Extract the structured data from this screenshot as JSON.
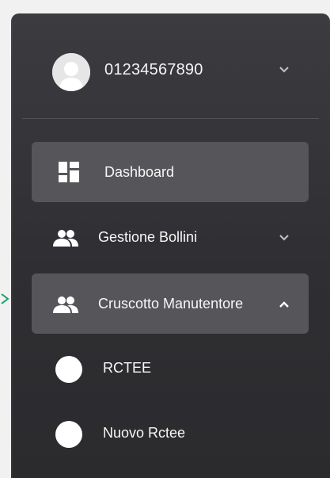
{
  "user": {
    "name": "01234567890"
  },
  "nav": {
    "dashboard": "Dashboard",
    "gestione_bollini": "Gestione Bollini",
    "cruscotto": "Cruscotto Manutentore"
  },
  "submenu": {
    "items": [
      "RCTEE",
      "Nuovo Rctee"
    ]
  },
  "icons": {
    "user": "avatar-person-icon",
    "dashboard": "dashboard-grid-icon",
    "group": "people-group-icon",
    "expand": "chevron-down-icon",
    "collapse": "chevron-up-icon",
    "sub": "circle-bullet-icon"
  },
  "colors": {
    "sidebar": "#333337",
    "active_item": "#56565a",
    "text": "#f7f7f7",
    "marker": "#1e9e6e"
  }
}
